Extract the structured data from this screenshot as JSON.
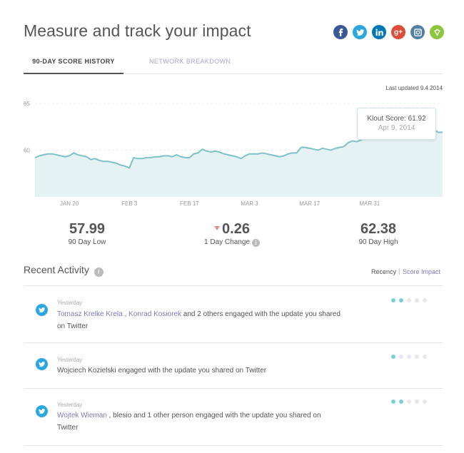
{
  "page": {
    "title": "Measure and track your impact"
  },
  "social": [
    {
      "name": "facebook-icon",
      "glyph": "f",
      "color": "#3b5998"
    },
    {
      "name": "twitter-icon",
      "glyph": "t",
      "color": "#2aa7e0"
    },
    {
      "name": "linkedin-icon",
      "glyph": "in",
      "color": "#0077b5"
    },
    {
      "name": "google-plus-icon",
      "glyph": "g+",
      "color": "#dd4b39"
    },
    {
      "name": "instagram-icon",
      "glyph": "ig",
      "color": "#517fa4"
    },
    {
      "name": "foursquare-icon",
      "glyph": "4",
      "color": "#8cc63f"
    }
  ],
  "tabs": {
    "history": "90-DAY SCORE HISTORY",
    "network": "NETWORK BREAKDOWN"
  },
  "last_updated": "Last updated 9.4.2014",
  "chart_data": {
    "type": "area",
    "ylim": [
      55,
      65
    ],
    "ytick_labels": [
      "65",
      "60"
    ],
    "yticks": [
      65,
      60
    ],
    "xtick_labels": [
      "JAN 20",
      "FEB 3",
      "FEB 17",
      "MAR 3",
      "MAR 17",
      "MAR 31"
    ],
    "xtick_index": [
      8,
      22,
      36,
      50,
      64,
      78
    ],
    "values": [
      59.2,
      59.4,
      59.5,
      59.6,
      59.6,
      59.5,
      59.4,
      59.3,
      59.4,
      59.7,
      59.5,
      59.4,
      59.3,
      59.0,
      59.1,
      58.9,
      58.8,
      58.8,
      58.7,
      58.6,
      58.4,
      58.3,
      58.1,
      59.2,
      59.1,
      59.1,
      59.2,
      59.2,
      59.3,
      59.3,
      59.4,
      59.4,
      59.3,
      59.5,
      59.3,
      59.2,
      59.2,
      59.6,
      59.7,
      60.1,
      59.9,
      59.8,
      59.9,
      59.8,
      59.6,
      59.5,
      59.4,
      59.3,
      59.1,
      59.4,
      59.6,
      59.6,
      59.6,
      59.7,
      59.6,
      59.5,
      59.4,
      59.3,
      59.4,
      59.6,
      59.7,
      59.7,
      60.3,
      60.3,
      60.2,
      60.1,
      60.0,
      60.2,
      60.1,
      60.0,
      60.2,
      60.3,
      60.4,
      60.8,
      61.0,
      60.9,
      61.1,
      61.4,
      61.6,
      61.8,
      61.7,
      61.5,
      61.3,
      61.5,
      61.6,
      61.6,
      61.8,
      62.0,
      62.2,
      61.9,
      61.92,
      62.2,
      62.3,
      62.2,
      61.9,
      61.92
    ],
    "line_color": "#7ec2c8",
    "fill_color": "#e5f2f3",
    "tooltip": {
      "score": "Klout Score: 61.92",
      "date": "Apr 9, 2014"
    }
  },
  "stats": {
    "low": {
      "value": "57.99",
      "label": "90 Day Low"
    },
    "change": {
      "value": "0.26",
      "label": "1 Day Change"
    },
    "high": {
      "value": "62.38",
      "label": "90 Day High"
    }
  },
  "recent": {
    "title": "Recent Activity",
    "sort_recency": "Recency",
    "sort_impact": "Score Impact"
  },
  "activities": [
    {
      "when": "Yesterday",
      "link1": "Tomasz Krelke Krela",
      "sep": " , ",
      "link2": "Konrad Kosiorek",
      "rest": " and 2 others engaged with the update you shared on Twitter",
      "dots": 2
    },
    {
      "when": "Yesterday",
      "text": "Wojciech Kozielski engaged with the update you shared on Twitter",
      "dots": 1
    },
    {
      "when": "Yesterday",
      "link1": "Wojtek Wieman",
      "rest": " , blesio and 1 other person engaged with the update you shared on Twitter",
      "dots": 2
    }
  ]
}
